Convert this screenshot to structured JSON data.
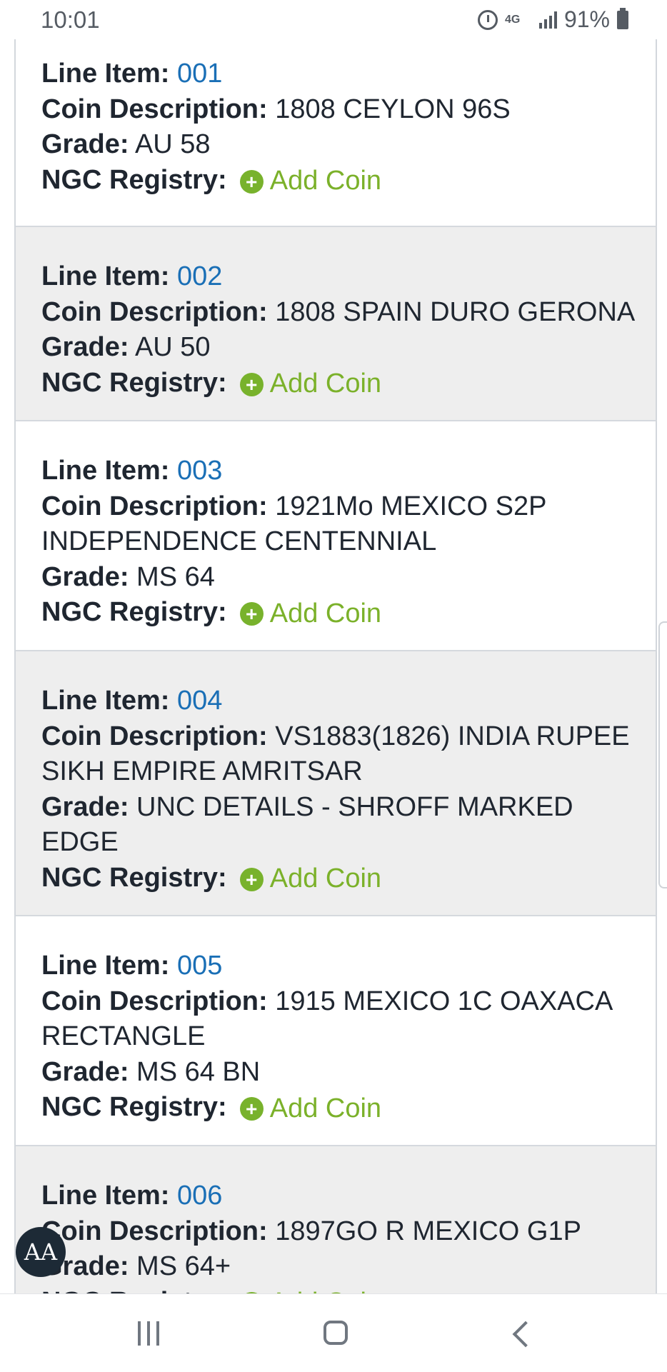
{
  "status_bar": {
    "time": "10:01",
    "network": "4G",
    "battery": "91%"
  },
  "labels": {
    "line_item": "Line Item:",
    "coin_description": "Coin Description:",
    "grade": "Grade:",
    "ngc_registry": "NGC Registry:",
    "add_coin": "Add Coin"
  },
  "items": [
    {
      "line": "001",
      "description": "1808 CEYLON 96S",
      "grade": "AU 58"
    },
    {
      "line": "002",
      "description": "1808 SPAIN DURO GERONA",
      "grade": "AU 50"
    },
    {
      "line": "003",
      "description": "1921Mo MEXICO S2P INDEPENDENCE CENTENNIAL",
      "grade": "MS 64"
    },
    {
      "line": "004",
      "description": "VS1883(1826) INDIA RUPEE SIKH EMPIRE AMRITSAR",
      "grade": "UNC DETAILS - SHROFF MARKED EDGE"
    },
    {
      "line": "005",
      "description": "1915 MEXICO 1C OAXACA RECTANGLE",
      "grade": "MS 64 BN"
    },
    {
      "line": "006",
      "description": "1897GO R MEXICO G1P",
      "grade": "MS 64+"
    }
  ],
  "font_size_button": "AA",
  "colors": {
    "link": "#1a6fb6",
    "add_coin": "#7bb12a",
    "alt_row": "#eeeeee"
  }
}
